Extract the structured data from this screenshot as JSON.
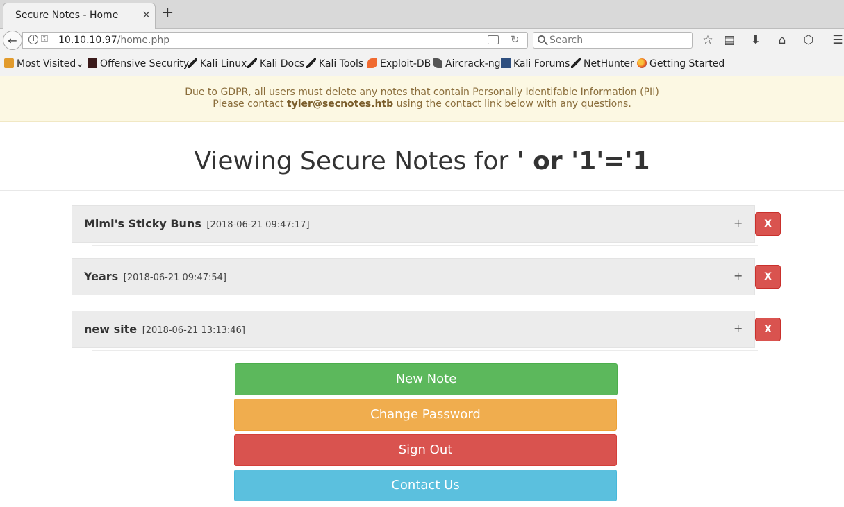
{
  "browser": {
    "tab_title": "Secure Notes - Home",
    "tab_close": "×",
    "new_tab": "+",
    "back": "←",
    "url_host": "10.10.10.97",
    "url_path": "/home.php",
    "reload": "↻",
    "search_placeholder": "Search",
    "toolbar_icons": {
      "bookmark_star": "☆",
      "reading_list": "▤",
      "downloads": "⬇",
      "home": "⌂",
      "pocket": "⬡",
      "menu": "☰"
    }
  },
  "bookmarks": [
    {
      "label": "Most Visited",
      "icon": "folder-icon",
      "suffix": "⌄"
    },
    {
      "label": "Offensive Security",
      "icon": "offsec-icon"
    },
    {
      "label": "Kali Linux",
      "icon": "kali-dragon-icon"
    },
    {
      "label": "Kali Docs",
      "icon": "kali-dragon-icon"
    },
    {
      "label": "Kali Tools",
      "icon": "kali-dragon-icon"
    },
    {
      "label": "Exploit-DB",
      "icon": "exploit-db-icon"
    },
    {
      "label": "Aircrack-ng",
      "icon": "aircrack-icon"
    },
    {
      "label": "Kali Forums",
      "icon": "kali-forums-icon"
    },
    {
      "label": "NetHunter",
      "icon": "kali-dragon-icon"
    },
    {
      "label": "Getting Started",
      "icon": "firefox-icon"
    }
  ],
  "banner": {
    "line1": "Due to GDPR, all users must delete any notes that contain Personally Identifable Information (PII)",
    "line2_pre": "Please contact ",
    "line2_email": "tyler@secnotes.htb",
    "line2_post": " using the contact link below with any questions."
  },
  "heading": {
    "prefix": "Viewing Secure Notes for ",
    "username": "' or '1'='1"
  },
  "notes": [
    {
      "title": "Mimi's Sticky Buns",
      "date": "[2018-06-21 09:47:17]",
      "expand": "+",
      "delete": "X"
    },
    {
      "title": "Years",
      "date": "[2018-06-21 09:47:54]",
      "expand": "+",
      "delete": "X"
    },
    {
      "title": "new site",
      "date": "[2018-06-21 13:13:46]",
      "expand": "+",
      "delete": "X"
    }
  ],
  "actions": {
    "new_note": "New Note",
    "change_password": "Change Password",
    "sign_out": "Sign Out",
    "contact_us": "Contact Us"
  },
  "colors": {
    "new_note": "#5cb85c",
    "change_password": "#f0ad4e",
    "sign_out": "#d9534f",
    "contact_us": "#5bc0de",
    "delete": "#d9534f",
    "banner_bg": "#fcf8e3",
    "banner_text": "#8a6d3b"
  }
}
